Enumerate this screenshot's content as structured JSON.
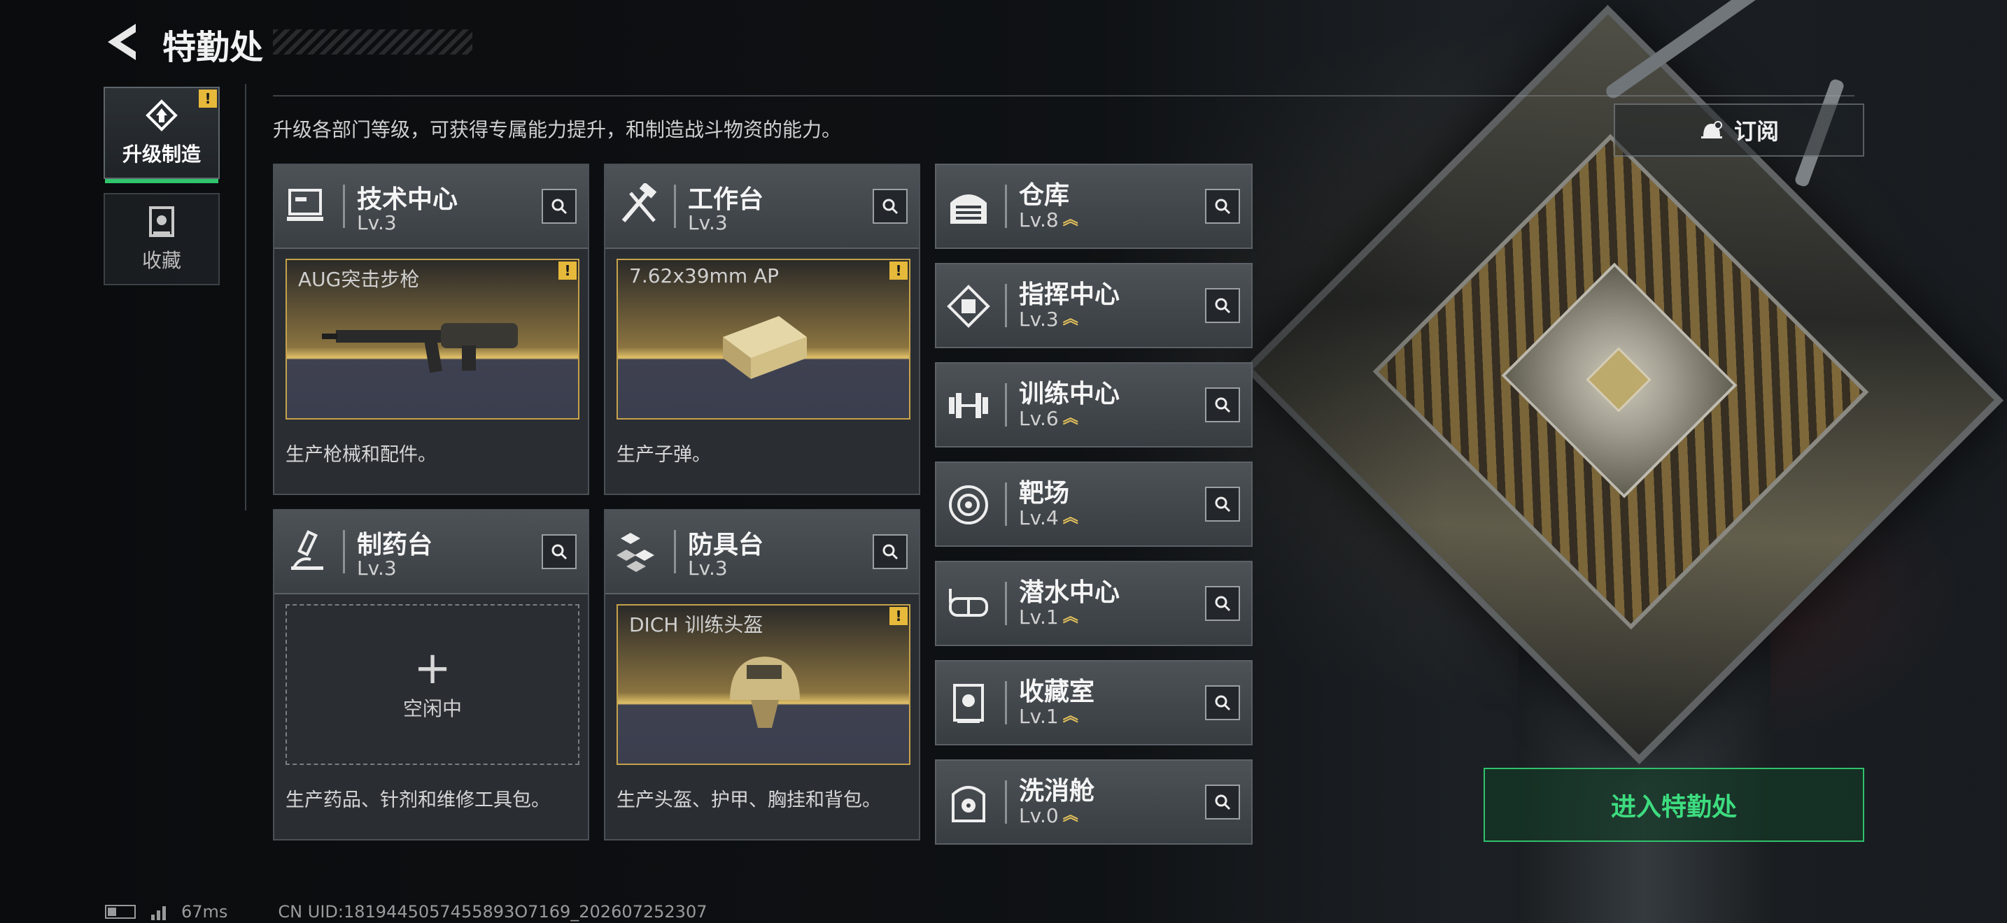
{
  "header": {
    "title": "特勤处"
  },
  "nav": [
    {
      "label": "升级制造",
      "active": true,
      "warn": "!"
    },
    {
      "label": "收藏",
      "active": false
    }
  ],
  "description": "升级各部门等级，可获得专属能力提升，和制造战斗物资的能力。",
  "subscribe_label": "订阅",
  "facilities": [
    {
      "name": "技术中心",
      "level": "Lv.3",
      "slot": "AUG突击步枪",
      "warn": "!",
      "desc": "生产枪械和配件。",
      "icon": "tech-center-icon"
    },
    {
      "name": "工作台",
      "level": "Lv.3",
      "slot": "7.62x39mm AP",
      "warn": "!",
      "desc": "生产子弹。",
      "icon": "workbench-icon"
    },
    {
      "name": "制药台",
      "level": "Lv.3",
      "slot_plus": "+",
      "slot_idle": "空闲中",
      "desc": "生产药品、针剂和维修工具包。",
      "icon": "pharmacy-icon"
    },
    {
      "name": "防具台",
      "level": "Lv.3",
      "slot": "DICH 训练头盔",
      "warn": "!",
      "desc": "生产头盔、护甲、胸挂和背包。",
      "icon": "armor-bench-icon"
    }
  ],
  "side_facilities": [
    {
      "name": "仓库",
      "level": "Lv.8",
      "icon": "warehouse-icon"
    },
    {
      "name": "指挥中心",
      "level": "Lv.3",
      "icon": "command-center-icon"
    },
    {
      "name": "训练中心",
      "level": "Lv.6",
      "icon": "training-center-icon"
    },
    {
      "name": "靶场",
      "level": "Lv.4",
      "icon": "shooting-range-icon"
    },
    {
      "name": "潜水中心",
      "level": "Lv.1",
      "icon": "diving-center-icon"
    },
    {
      "name": "收藏室",
      "level": "Lv.1",
      "icon": "collection-room-icon"
    },
    {
      "name": "洗消舱",
      "level": "Lv.0",
      "icon": "decon-chamber-icon"
    }
  ],
  "upgrade_chevron": "︽",
  "enter_label": "进入特勤处",
  "footer": {
    "ping": "67ms",
    "uid": "CN UID:1819445057455893O7169_202607252307"
  },
  "colors": {
    "accent_green": "#31c46d",
    "warn_yellow": "#e6b93a",
    "gold": "#c6a24b"
  }
}
